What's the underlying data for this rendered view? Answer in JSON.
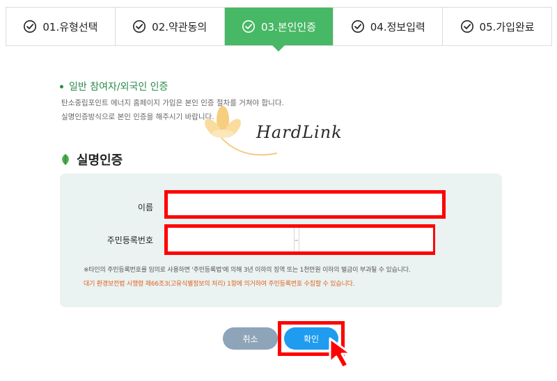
{
  "steps": [
    {
      "label": "01.유형선택",
      "active": false
    },
    {
      "label": "02.약관동의",
      "active": false
    },
    {
      "label": "03.본인인증",
      "active": true
    },
    {
      "label": "04.정보입력",
      "active": false
    },
    {
      "label": "05.가입완료",
      "active": false
    }
  ],
  "intro": {
    "title": "일반 참여자/외국인 인증",
    "line1": "탄소중립포인트 에너지 홈페이지 가입은 본인 인증 절차를 거쳐야 합니다.",
    "line2": "실명인증방식으로 본인 인증을 해주시기 바랍니다."
  },
  "watermark": {
    "text": "HardLink"
  },
  "section": {
    "title": "실명인증"
  },
  "form": {
    "name_label": "이름",
    "name_value": "",
    "rrn_label": "주민등록번호",
    "rrn_front_value": "",
    "rrn_dash": "–",
    "rrn_back_value": ""
  },
  "notices": {
    "n1": "※타인의 주민등록번호를 임의로 사용하면 '주민등록법'에 의해 3년 이하의 징역 또는 1천만원 이하의 벌금이 부과될 수 있습니다.",
    "n2": "대기 환경보전법 시행령 제66조3(고유식별정보의 처리) 1항에 의거하여 주민등록번호 수집할 수 있습니다."
  },
  "buttons": {
    "cancel": "취소",
    "confirm": "확인"
  },
  "colors": {
    "active_step": "#47b865",
    "highlight": "#ff0000",
    "confirm": "#1f9bf0",
    "cancel": "#8ea4b9"
  },
  "icons": {
    "step": "check-circle-icon",
    "section": "leaf-icon",
    "cursor": "cursor-arrow-icon"
  }
}
